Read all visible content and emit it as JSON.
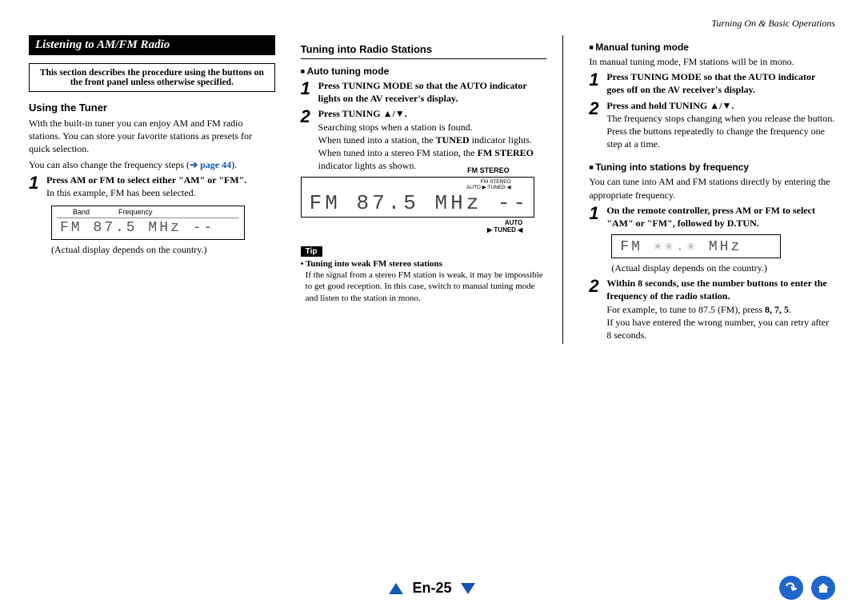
{
  "header": {
    "breadcrumb": "Turning On & Basic Operations"
  },
  "col1": {
    "banner": "Listening to AM/FM Radio",
    "note_box": "This section describes the procedure using the buttons on the front panel unless otherwise specified.",
    "h_using": "Using the Tuner",
    "p1": "With the built-in tuner you can enjoy AM and FM radio stations. You can store your favorite stations as presets for quick selection.",
    "p2a": "You can also change the frequency steps (",
    "p2_arrow": "➔",
    "p2_link": "page 44",
    "p2b": ").",
    "step1_lead": "Press AM or FM to select either \"AM\" or \"FM\".",
    "step1_body": "In this example, FM has been selected.",
    "disp_label_band": "Band",
    "disp_label_freq": "Frequency",
    "disp_seg": "FM  87.5 MHz --",
    "actual": "(Actual display depends on the country.)"
  },
  "col2": {
    "h_tuning": "Tuning into Radio Stations",
    "sub_auto": "Auto tuning mode",
    "s1_lead": "Press TUNING MODE so that the AUTO indicator lights on the AV receiver's display.",
    "s2_lead": "Press TUNING ▲/▼.",
    "s2_body1": "Searching stops when a station is found.",
    "s2_body2a": "When tuned into a station, the ",
    "s2_body2b": "TUNED",
    "s2_body2c": " indicator lights. When tuned into a stereo FM station, the ",
    "s2_body2d": "FM STEREO",
    "s2_body2e": " indicator lights as shown.",
    "disp_fmstereo_label": "FM STEREO",
    "disp_inner1": "FM STEREO",
    "disp_inner2": "AUTO ▶ TUNED ◀",
    "disp_seg": "FM  87.5 MHz --",
    "disp_bottom1": "AUTO",
    "disp_bottom2": "▶ TUNED ◀",
    "tip_label": "Tip",
    "tip_title": "• Tuning into weak FM stereo stations",
    "tip_body": "If the signal from a stereo FM station is weak, it may be impossible to get good reception. In this case, switch to manual tuning mode and listen to the station in mono."
  },
  "col3": {
    "sub_manual": "Manual tuning mode",
    "p1": "In manual tuning mode, FM stations will be in mono.",
    "s1_lead": "Press TUNING MODE so that the AUTO indicator goes off on the AV receiver's display.",
    "s2_lead": "Press and hold TUNING ▲/▼.",
    "s2_body1": "The frequency stops changing when you release the button.",
    "s2_body2": "Press the buttons repeatedly to change the frequency one step at a time.",
    "sub_byfreq": "Tuning into stations by frequency",
    "p2": "You can tune into AM and FM stations directly by entering the appropriate frequency.",
    "bf_s1_lead": "On the remote controller, press AM or FM to select \"AM\" or \"FM\", followed by D.TUN.",
    "disp_seg_a": "FM ",
    "disp_seg_b": "✳✳.✳",
    "disp_seg_c": " MHz",
    "actual": "(Actual display depends on the country.)",
    "bf_s2_lead": "Within 8 seconds, use the number buttons to enter the frequency of the radio station.",
    "bf_s2_body_a": "For example, to tune to 87.5 (FM), press ",
    "bf_s2_body_b": "8, 7, 5",
    "bf_s2_body_c": ".",
    "bf_s2_body2": "If you have entered the wrong number, you can retry after 8 seconds."
  },
  "footer": {
    "page": "En-25"
  }
}
